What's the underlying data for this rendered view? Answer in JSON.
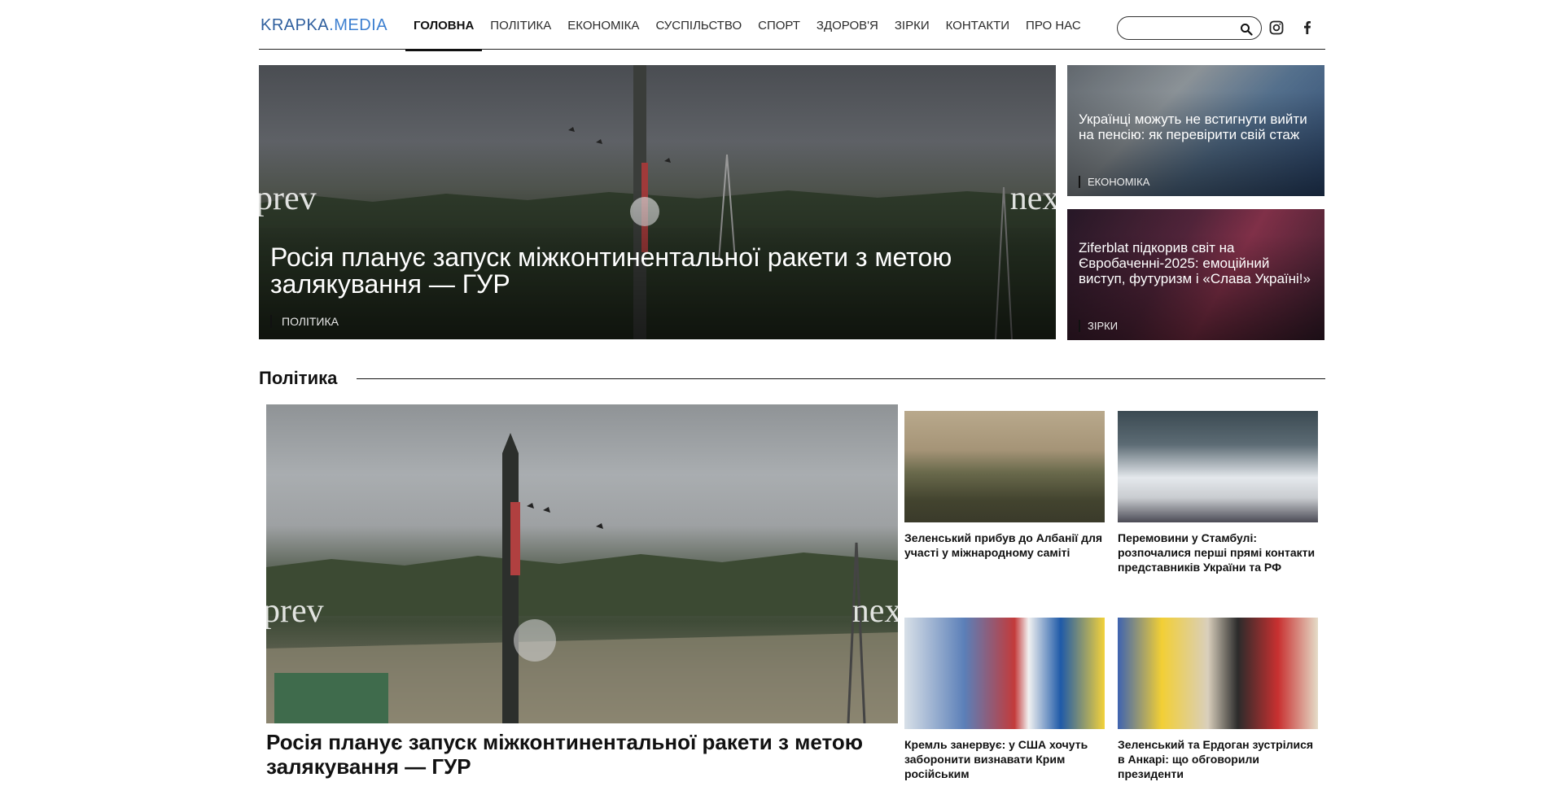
{
  "brand": {
    "logo_part1": "KRAPKA",
    "logo_part2": ".MEDIA",
    "colors": {
      "primary": "#2f5f9e",
      "accent": "#e3c341",
      "text": "#111111"
    }
  },
  "nav": {
    "items": [
      {
        "label": "Головна",
        "active": true
      },
      {
        "label": "Політика",
        "active": false
      },
      {
        "label": "Економіка",
        "active": false
      },
      {
        "label": "Суспільство",
        "active": false
      },
      {
        "label": "Спорт",
        "active": false
      },
      {
        "label": "Здоров'я",
        "active": false
      },
      {
        "label": "Зірки",
        "active": false
      },
      {
        "label": "Контакти",
        "active": false
      },
      {
        "label": "Про нас",
        "active": false
      }
    ]
  },
  "search": {
    "value": "",
    "placeholder": "",
    "icon": "search-icon"
  },
  "social": {
    "instagram_icon": "instagram-icon",
    "facebook_icon": "facebook-icon"
  },
  "hero": {
    "prev_label": "prev",
    "next_label": "next",
    "main": {
      "title": "Росія планує запуск міжконтинентальної ракети з метою залякування — ГУР",
      "category": "Політика"
    },
    "side": [
      {
        "title": "Українці можуть не встигнути вийти на пенсію: як перевірити свій стаж",
        "category": "Економіка"
      },
      {
        "title": "Ziferblat підкорив світ на Євробаченні-2025: емоційний виступ, футуризм і «Слава Україні!»",
        "category": "Зірки"
      }
    ]
  },
  "politics": {
    "title": "Політика",
    "prev_label": "prev",
    "next_label": "next",
    "main_title": "Росія планує запуск міжконтинентальної ракети з метою залякування — ГУР",
    "cards": [
      {
        "title": "Зеленський прибув до Албанії для участі у міжнародному саміті"
      },
      {
        "title": "Перемовини у Стамбулі: розпочалися перші прямі контакти представників України та РФ"
      },
      {
        "title": "Кремль занервує: у США хочуть заборонити визнавати Крим російським"
      },
      {
        "title": "Зеленський та Ердоган зустрілися в Анкарі: що обговорили президенти"
      }
    ]
  }
}
